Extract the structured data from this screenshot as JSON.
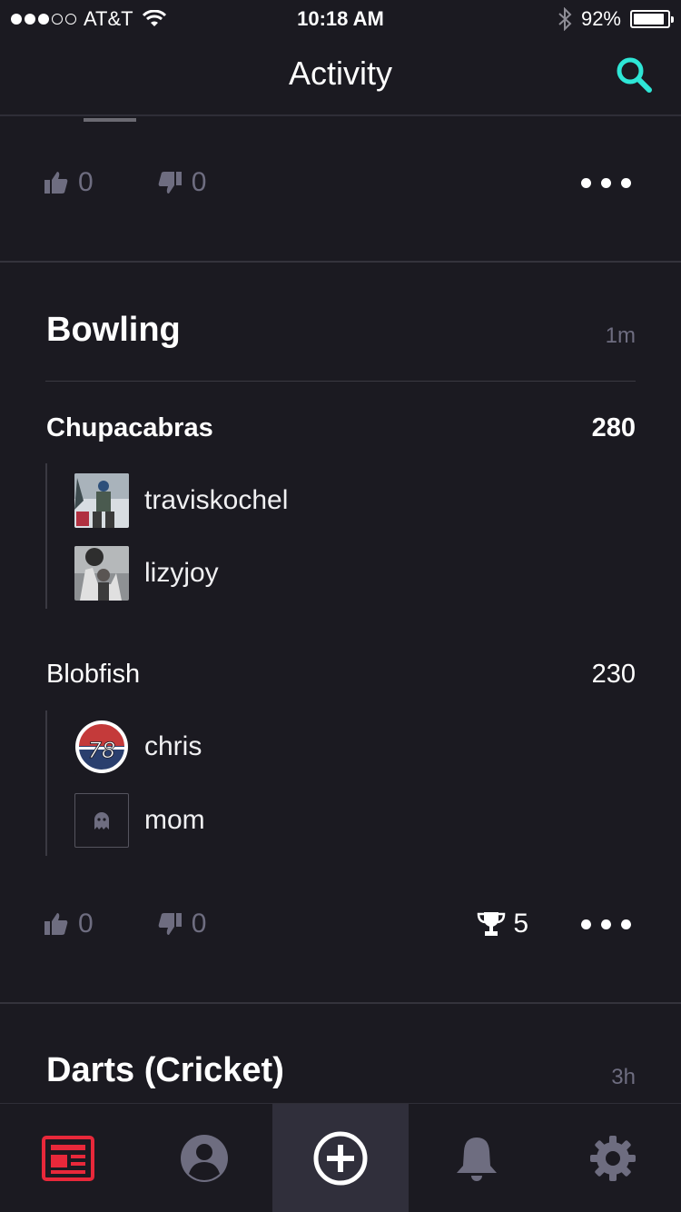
{
  "status_bar": {
    "carrier": "AT&T",
    "time": "10:18 AM",
    "battery": "92%",
    "battery_level": 0.92
  },
  "nav": {
    "title": "Activity",
    "search_icon": "search-icon",
    "accent_color": "#2ee6d6"
  },
  "feed": {
    "top_card": {
      "likes": "0",
      "dislikes": "0"
    },
    "bowling_card": {
      "title": "Bowling",
      "time": "1m",
      "teams": [
        {
          "name": "Chupacabras",
          "score": "280",
          "players": [
            {
              "name": "traviskochel"
            },
            {
              "name": "lizyjoy"
            }
          ]
        },
        {
          "name": "Blobfish",
          "score": "230",
          "players": [
            {
              "name": "chris"
            },
            {
              "name": "mom"
            }
          ]
        }
      ],
      "likes": "0",
      "dislikes": "0",
      "trophies": "5"
    },
    "darts_card": {
      "title": "Darts (Cricket)",
      "time": "3h"
    }
  },
  "tabbar": {
    "items": [
      {
        "icon": "news-feed-icon",
        "color": "#e8283a"
      },
      {
        "icon": "profile-icon",
        "color": "#6e6d80"
      },
      {
        "icon": "add-game-icon",
        "color": "#ffffff"
      },
      {
        "icon": "notifications-bell-icon",
        "color": "#6e6d80"
      },
      {
        "icon": "settings-gear-icon",
        "color": "#6e6d80"
      }
    ]
  }
}
